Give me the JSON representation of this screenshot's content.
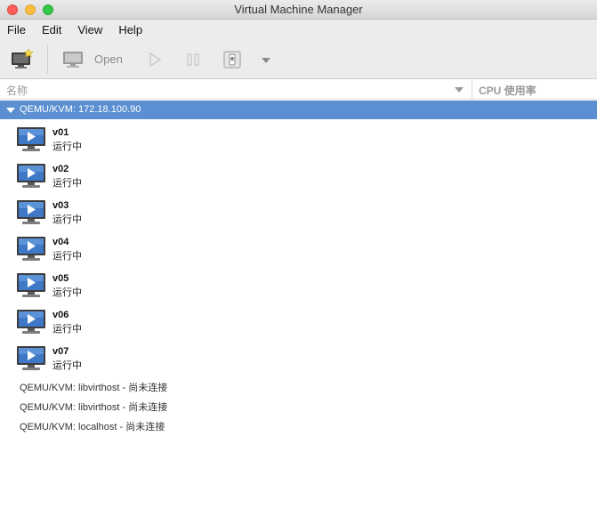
{
  "window": {
    "title": "Virtual Machine Manager"
  },
  "menubar": {
    "items": [
      "File",
      "Edit",
      "View",
      "Help"
    ]
  },
  "toolbar": {
    "open_label": "Open"
  },
  "columns": {
    "name": "名称",
    "cpu": "CPU 使用率"
  },
  "connections": [
    {
      "label": "QEMU/KVM: 172.18.100.90",
      "expanded": true,
      "vms": [
        {
          "name": "v01",
          "status": "运行中"
        },
        {
          "name": "v02",
          "status": "运行中"
        },
        {
          "name": "v03",
          "status": "运行中"
        },
        {
          "name": "v04",
          "status": "运行中"
        },
        {
          "name": "v05",
          "status": "运行中"
        },
        {
          "name": "v06",
          "status": "运行中"
        },
        {
          "name": "v07",
          "status": "运行中"
        }
      ]
    }
  ],
  "other_connections": [
    "QEMU/KVM: libvirthost - 尚未连接",
    "QEMU/KVM: libvirthost - 尚未连接",
    "QEMU/KVM: localhost - 尚未连接"
  ],
  "colors": {
    "selection": "#5b8fd1",
    "close": "#fc605c",
    "minimize": "#fdbc40",
    "maximize": "#34c84a"
  }
}
